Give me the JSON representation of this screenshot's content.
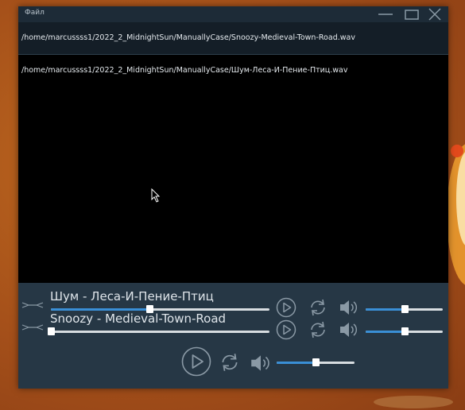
{
  "window": {
    "menu_file": "Файл"
  },
  "path_bar": {
    "path_1": "/home/marcussss1/2022_2_MidnightSun/ManuallyCase/Snoozy-Medieval-Town-Road.wav"
  },
  "output": {
    "path_2": "/home/marcussss1/2022_2_MidnightSun/ManuallyCase/Шум-Леса-И-Пение-Птиц.wav"
  },
  "tracks": [
    {
      "title": "Шум - Леса-И-Пение-Птиц",
      "progress": 0.45,
      "volume": 0.5
    },
    {
      "title": "Snoozy - Medieval-Town-Road",
      "progress": 0.0,
      "volume": 0.5
    }
  ],
  "master": {
    "volume": 0.5
  },
  "colors": {
    "accent": "#3a8fd6",
    "window_bg": "#263745",
    "titlebar_bg": "#1d2b37",
    "icon": "#8a99a5"
  },
  "icons": {
    "play": "play-circle-icon",
    "loop": "loop-icon",
    "speaker": "speaker-icon",
    "handle": "drag-handle-icon",
    "minimize": "minimize-icon",
    "maximize": "maximize-icon",
    "close": "close-icon"
  }
}
